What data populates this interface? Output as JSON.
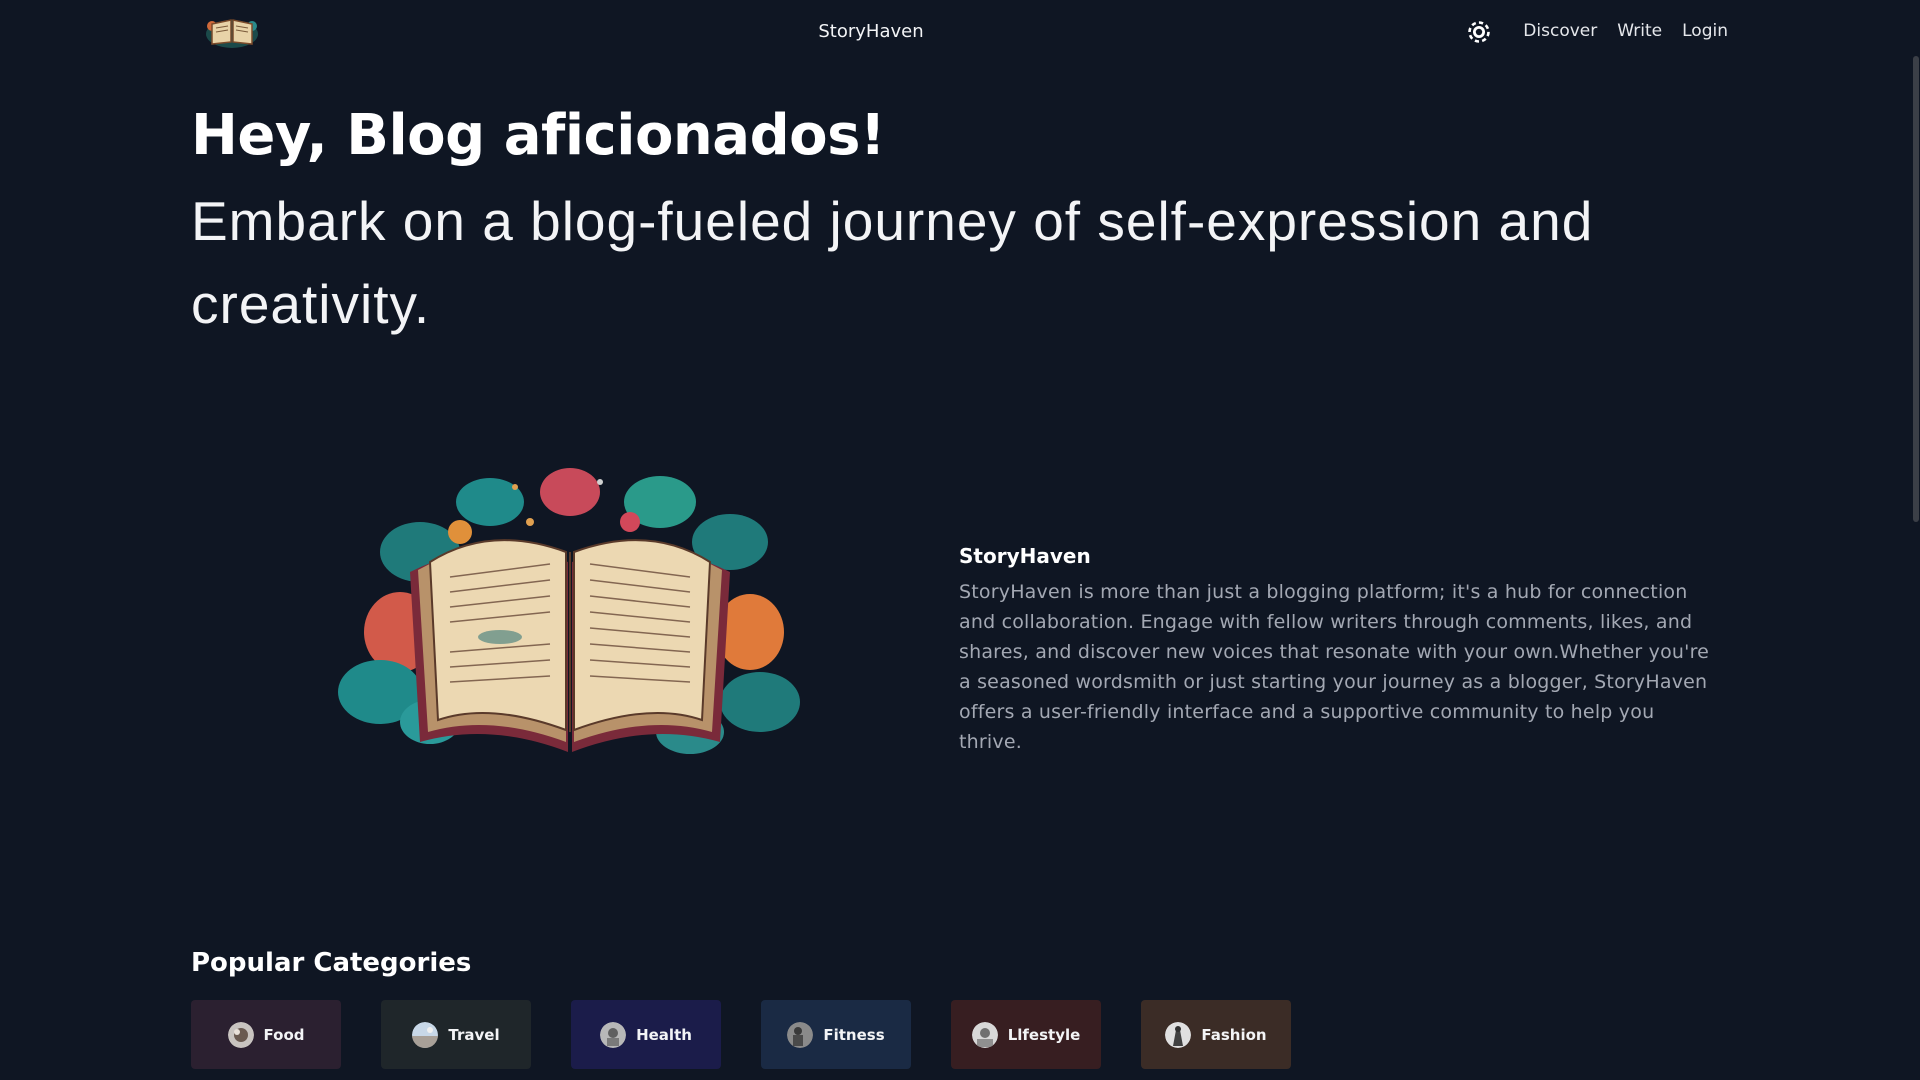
{
  "navbar": {
    "brand": "StoryHaven",
    "links": [
      "Discover",
      "Write",
      "Login"
    ]
  },
  "hero": {
    "title": "Hey, Blog aficionados!",
    "subtitle": "Embark on a blog-fueled journey of self-expression and creativity."
  },
  "about": {
    "title": "StoryHaven",
    "text": "StoryHaven is more than just a blogging platform; it's a hub for connection and collaboration. Engage with fellow writers through comments, likes, and shares, and discover new voices that resonate with your own.Whether you're a seasoned wordsmith or just starting your journey as a blogger, StoryHaven offers a user-friendly interface and a supportive community to help you thrive."
  },
  "categories": {
    "heading": "Popular Categories",
    "items": [
      {
        "label": "Food",
        "color": "#2b2030"
      },
      {
        "label": "Travel",
        "color": "#1f262a"
      },
      {
        "label": "Health",
        "color": "#1b1c4a"
      },
      {
        "label": "Fitness",
        "color": "#1a2a44"
      },
      {
        "label": "Llfestyle",
        "color": "#371e21"
      },
      {
        "label": "Fashion",
        "color": "#3b2c26"
      }
    ]
  },
  "colors": {
    "background": "#0f1623",
    "text_muted": "#a3a8b3"
  }
}
